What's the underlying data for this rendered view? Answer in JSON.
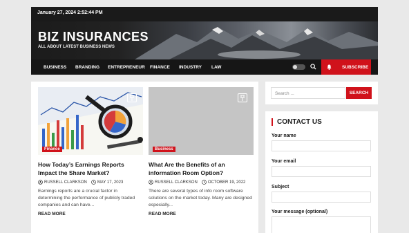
{
  "topbar": {
    "datetime": "January 27, 2024 2:52:44 PM"
  },
  "header": {
    "title": "BIZ INSURANCES",
    "tagline": "ALL ABOUT LATEST BUSINESS NEWS"
  },
  "nav": {
    "items": [
      "BUSINESS",
      "BRANDING",
      "ENTREPRENEUR",
      "FINANCE",
      "INDUSTRY",
      "LAW"
    ],
    "subscribe": "SUBSCRIBE"
  },
  "posts": [
    {
      "category": "Finance",
      "title": "How Today’s Earnings Reports Impact the Share Market?",
      "author": "RUSSELL CLARKSON",
      "date": "MAY 17, 2023",
      "excerpt": "Earnings reports are a crucial factor in determining the performance of publicly traded companies and can have...",
      "read_more": "READ MORE"
    },
    {
      "category": "Business",
      "title": "What Are the Benefits of an information Room Option?",
      "author": "RUSSELL CLARKSON",
      "date": "OCTOBER 19, 2022",
      "excerpt": "There are several types of info room software solutions on the market today. Many are designed especially...",
      "read_more": "READ MORE"
    }
  ],
  "search": {
    "placeholder": "Search ...",
    "button": "SEARCH"
  },
  "contact": {
    "heading": "CONTACT US",
    "name_label": "Your name",
    "email_label": "Your email",
    "subject_label": "Subject",
    "message_label": "Your message (optional)"
  },
  "colors": {
    "accent": "#d0121b",
    "dark": "#161616"
  }
}
